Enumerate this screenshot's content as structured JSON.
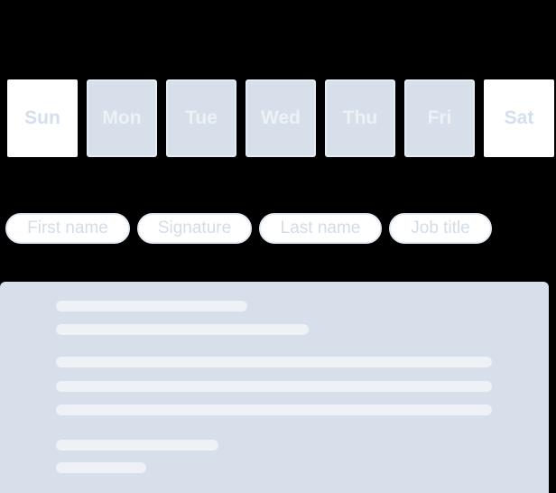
{
  "days": [
    {
      "label": "Sun",
      "selected": false
    },
    {
      "label": "Mon",
      "selected": true
    },
    {
      "label": "Tue",
      "selected": true
    },
    {
      "label": "Wed",
      "selected": true
    },
    {
      "label": "Thu",
      "selected": true
    },
    {
      "label": "Fri",
      "selected": true
    },
    {
      "label": "Sat",
      "selected": false
    }
  ],
  "fields": [
    {
      "label": "First name"
    },
    {
      "label": "Signature"
    },
    {
      "label": "Last name"
    },
    {
      "label": "Job title"
    }
  ],
  "colors": {
    "weekday_bg": "#d6dfea",
    "weekend_bg": "#ffffff",
    "chip_bg": "#ffffff",
    "placeholder_line": "#eef2f7",
    "background": "#000000"
  }
}
